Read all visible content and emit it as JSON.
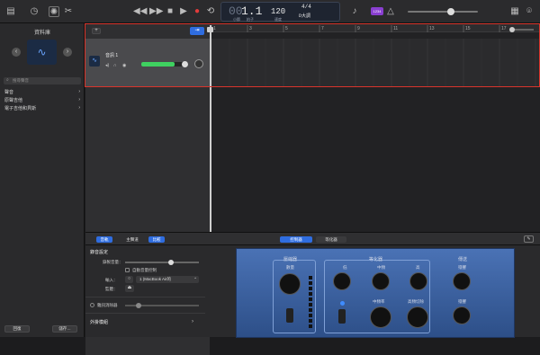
{
  "toolbar": {
    "lcd_bar_beat": "1.1",
    "lcd_bar_label": "小節",
    "lcd_beat_label": "拍子",
    "lcd_tempo": "120",
    "lcd_tempo_label": "速度",
    "lcd_signature": "4/4",
    "lcd_key": "D大調",
    "count_in_label": "1234"
  },
  "library": {
    "title": "資料庫",
    "search_placeholder": "搜尋聲音",
    "items": [
      {
        "label": "聲音"
      },
      {
        "label": "原聲吉他"
      },
      {
        "label": "電子吉他和貝斯"
      }
    ],
    "revert_label": "回復",
    "save_label": "儲存…"
  },
  "track": {
    "name": "音訊 1",
    "volume": 0.72
  },
  "ruler": {
    "marks": [
      "1",
      "3",
      "5",
      "7",
      "9",
      "11",
      "13",
      "15",
      "17"
    ]
  },
  "bottom": {
    "tabs": [
      "音軌",
      "主聲道",
      "比較"
    ],
    "center_tabs": [
      "控制器",
      "等化器"
    ],
    "recording_settings": "錄音設定",
    "record_level": "錄製音量：",
    "auto_level": "自動音量控制",
    "input_label": "輸入：",
    "input_value": "1 (MacBook Air的",
    "monitor_label": "監聽：",
    "noise_gate": "雜訊消除器",
    "plugins": "外掛模組",
    "compressor": "壓縮器",
    "compressor_amount": "數量",
    "eq_title": "等化器",
    "eq_low": "低",
    "eq_mid": "中頻",
    "eq_high": "高",
    "eq_midfreq": "中頻率",
    "eq_highcut": "高頻切除",
    "send_title": "傳送",
    "send_echo": "殘響",
    "send_reverb": "殘響"
  },
  "colors": {
    "accent": "#2f6de0",
    "selection": "#d9352c",
    "record": "#e23b3b",
    "lcd_bg": "#1e2430",
    "plugin_bg": "#3a5f9c"
  }
}
